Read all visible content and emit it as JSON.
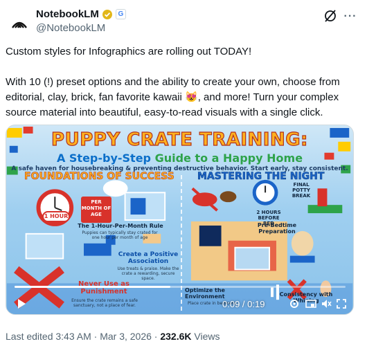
{
  "header": {
    "display_name": "NotebookLM",
    "handle": "@NotebookLM",
    "affiliate_badge": "G"
  },
  "tweet": {
    "line1": "Custom styles for Infographics are rolling out TODAY!",
    "line2_a": "With 10 (!) preset options and the ability to create your own, choose from editorial, clay, brick, fan favorite kawaii ",
    "emoji": "😻",
    "line2_b": ", and more! Turn your complex source material into beautiful, easy-to-read visuals with a single click."
  },
  "media": {
    "title": "PUPPY CRATE TRAINING:",
    "subtitle_a": "A Step-by-Step ",
    "subtitle_b": "Guide to a Happy Home",
    "tagline": "A safe haven for housebreaking & preventing destructive behavior. Start early, stay consistent.",
    "section_left": "FOUNDATIONS OF SUCCESS",
    "section_right": "MASTERING THE NIGHT",
    "one_hour": "1 HOUR",
    "per_month": "PER MONTH OF AGE",
    "rule_title": "The 1-Hour-Per-Month Rule",
    "rule_text": "Puppies can typically stay crated for one hour per month of age",
    "positive_title": "Create a Positive Association",
    "positive_text": "Use treats & praise. Make the crate a rewarding, secure space.",
    "never_title": "Never Use as Punishment",
    "never_text": "Ensure the crate remains a safe sanctuary, not a place of fear.",
    "two_hours": "2 HOURS BEFORE BED",
    "potty": "FINAL POTTY BREAK",
    "prebed": "Pre-Bedtime Preparation",
    "optimize": "Optimize the Environment",
    "optimize_text": "Place crate in bedroom",
    "consistency": "Consistency with Whining",
    "time_display": "0:09 / 0:19",
    "progress": 0.47
  },
  "footer": {
    "edited": "Last edited 3:43 AM · Mar 3, 2026 · ",
    "views_count": "232.6K",
    "views_label": " Views"
  },
  "colors": {
    "accent_orange": "#ffb11f",
    "accent_red": "#d8322b",
    "accent_blue": "#1b64c8"
  }
}
